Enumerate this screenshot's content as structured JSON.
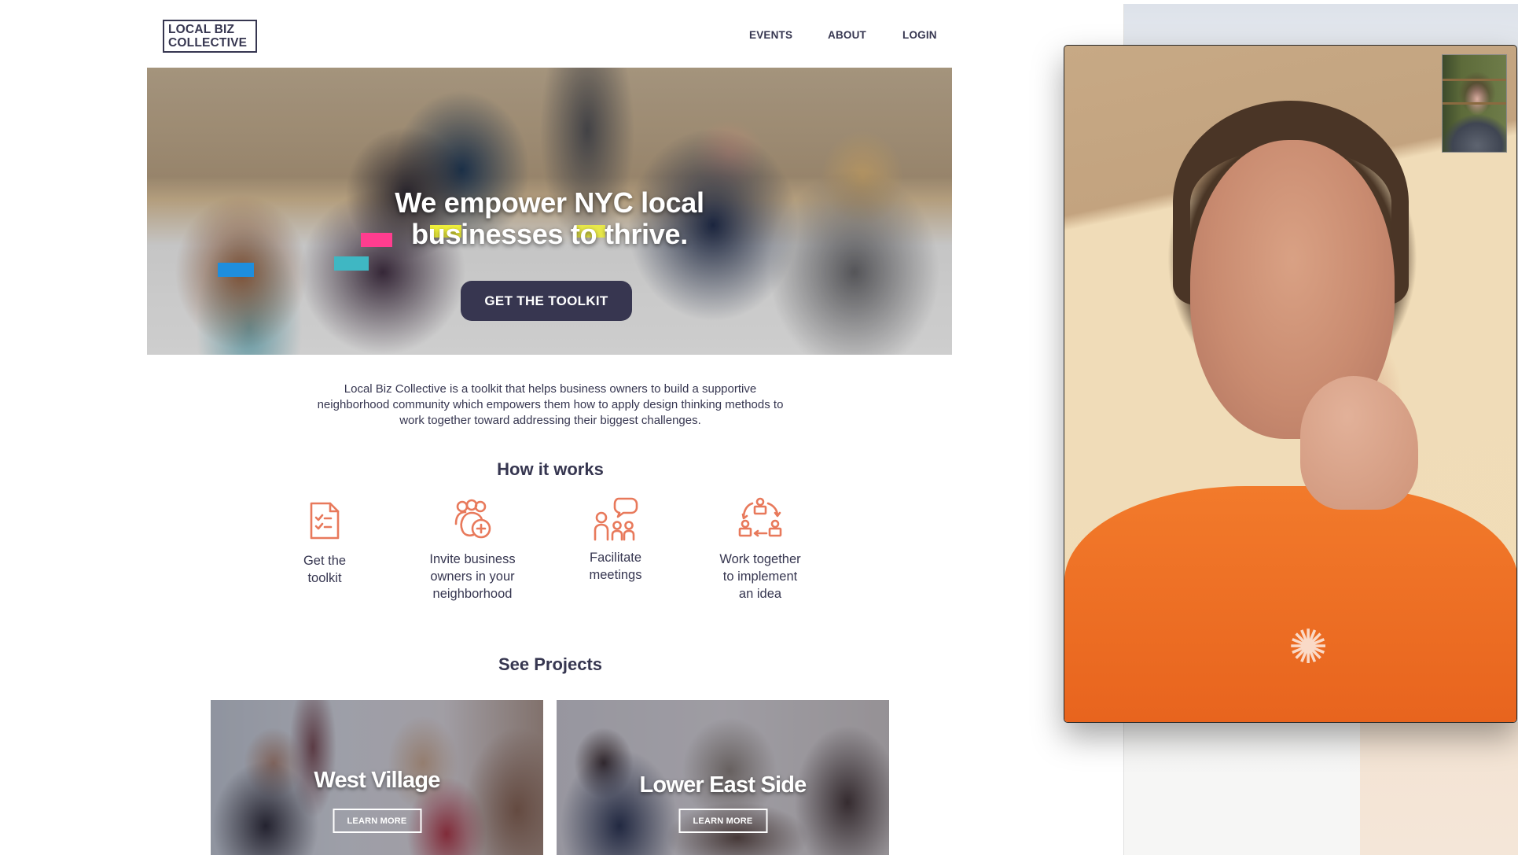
{
  "website": {
    "logo": {
      "line1": "LOCAL BIZ",
      "line2": "COLLECTIVE"
    },
    "nav": [
      {
        "label": "EVENTS"
      },
      {
        "label": "ABOUT"
      },
      {
        "label": "LOGIN"
      }
    ],
    "hero": {
      "title_line1": "We empower NYC local",
      "title_line2": "businesses to thrive.",
      "cta_label": "GET THE TOOLKIT"
    },
    "intro": "Local Biz Collective is a toolkit that helps business owners to build a supportive neighborhood community which empowers them how to apply design thinking methods to work together toward addressing their biggest challenges.",
    "how_it_works": {
      "title": "How it works",
      "accent_color": "#e8795b",
      "steps": [
        {
          "icon": "checklist-icon",
          "label_lines": [
            "Get the",
            "toolkit"
          ]
        },
        {
          "icon": "group-add-icon",
          "label_lines": [
            "Invite business",
            "owners in your",
            "neighborhood"
          ]
        },
        {
          "icon": "meeting-speech-icon",
          "label_lines": [
            "Facilitate",
            "meetings"
          ]
        },
        {
          "icon": "collaboration-cycle-icon",
          "label_lines": [
            "Work together",
            "to implement",
            "an idea"
          ]
        }
      ]
    },
    "projects": {
      "title": "See Projects",
      "cards": [
        {
          "title": "West Village",
          "button": "LEARN MORE"
        },
        {
          "title": "Lower East Side",
          "button": "LEARN MORE"
        }
      ]
    },
    "colors": {
      "text": "#363650",
      "button_bg": "#373650",
      "accent": "#e8795b"
    }
  },
  "video_call": {
    "remote_participant": "video-feed",
    "self_view": "pip-self-view"
  }
}
